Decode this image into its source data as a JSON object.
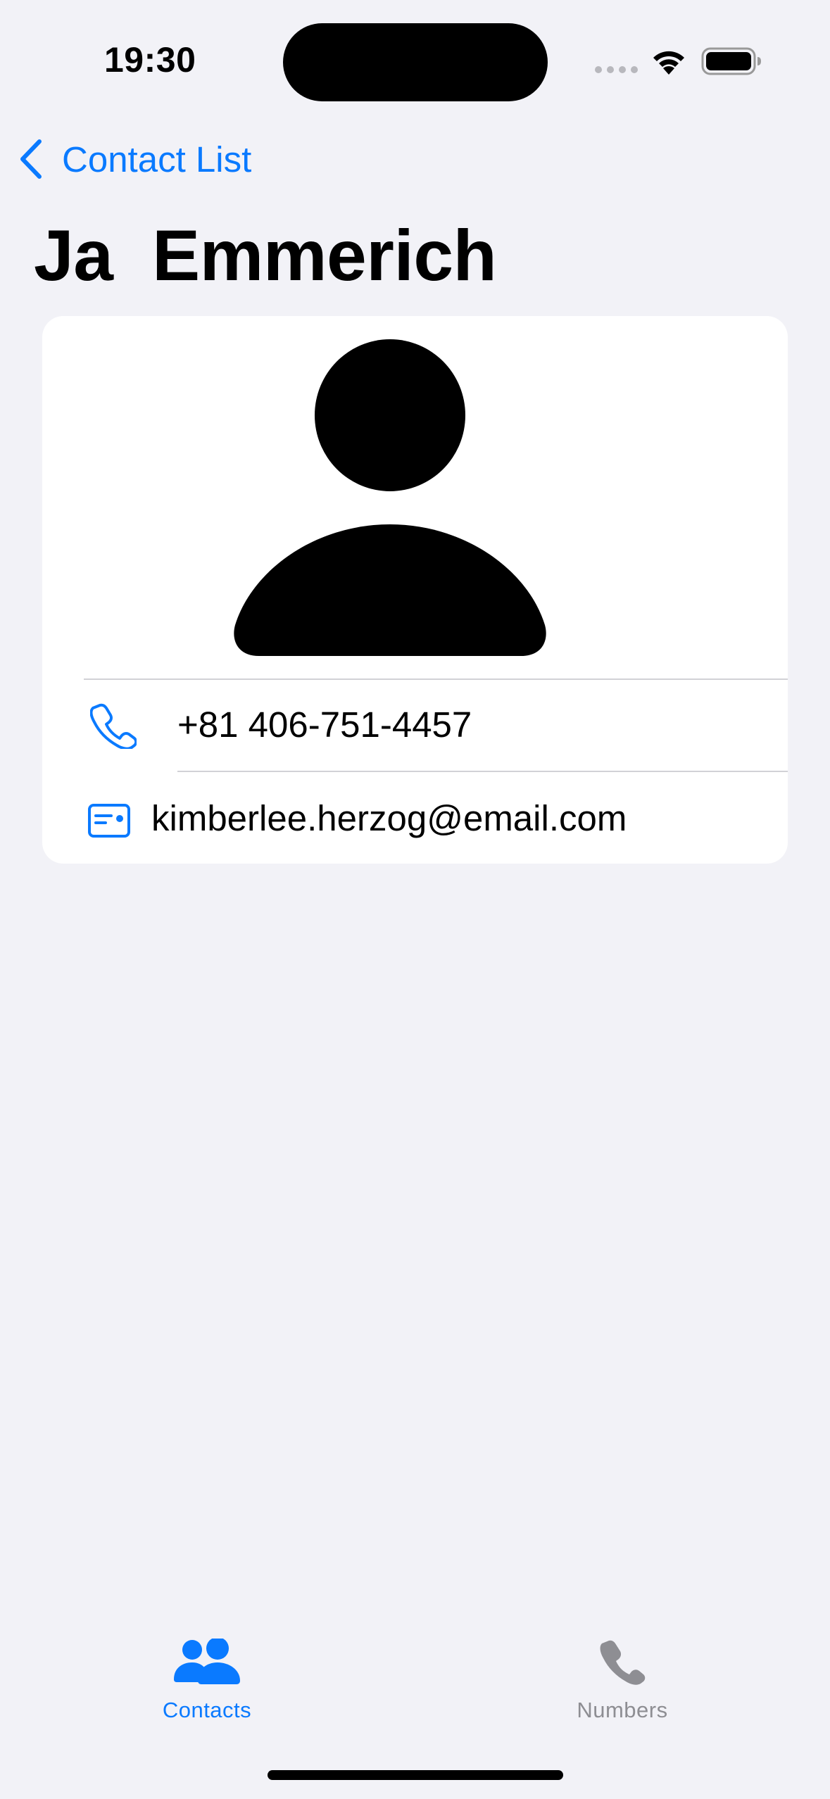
{
  "status_bar": {
    "time": "19:30"
  },
  "nav": {
    "back_label": "Contact List"
  },
  "contact": {
    "name": "Ja  Emmerich",
    "phone": "+81 406-751-4457",
    "email": "kimberlee.herzog@email.com"
  },
  "tab_bar": {
    "tabs": [
      {
        "label": "Contacts",
        "icon": "person-2-fill-icon",
        "selected": true
      },
      {
        "label": "Numbers",
        "icon": "phone-fill-icon",
        "selected": false
      }
    ]
  },
  "colors": {
    "accent": "#0a7aff",
    "background": "#f2f2f7",
    "inactive": "#8e8e93"
  }
}
